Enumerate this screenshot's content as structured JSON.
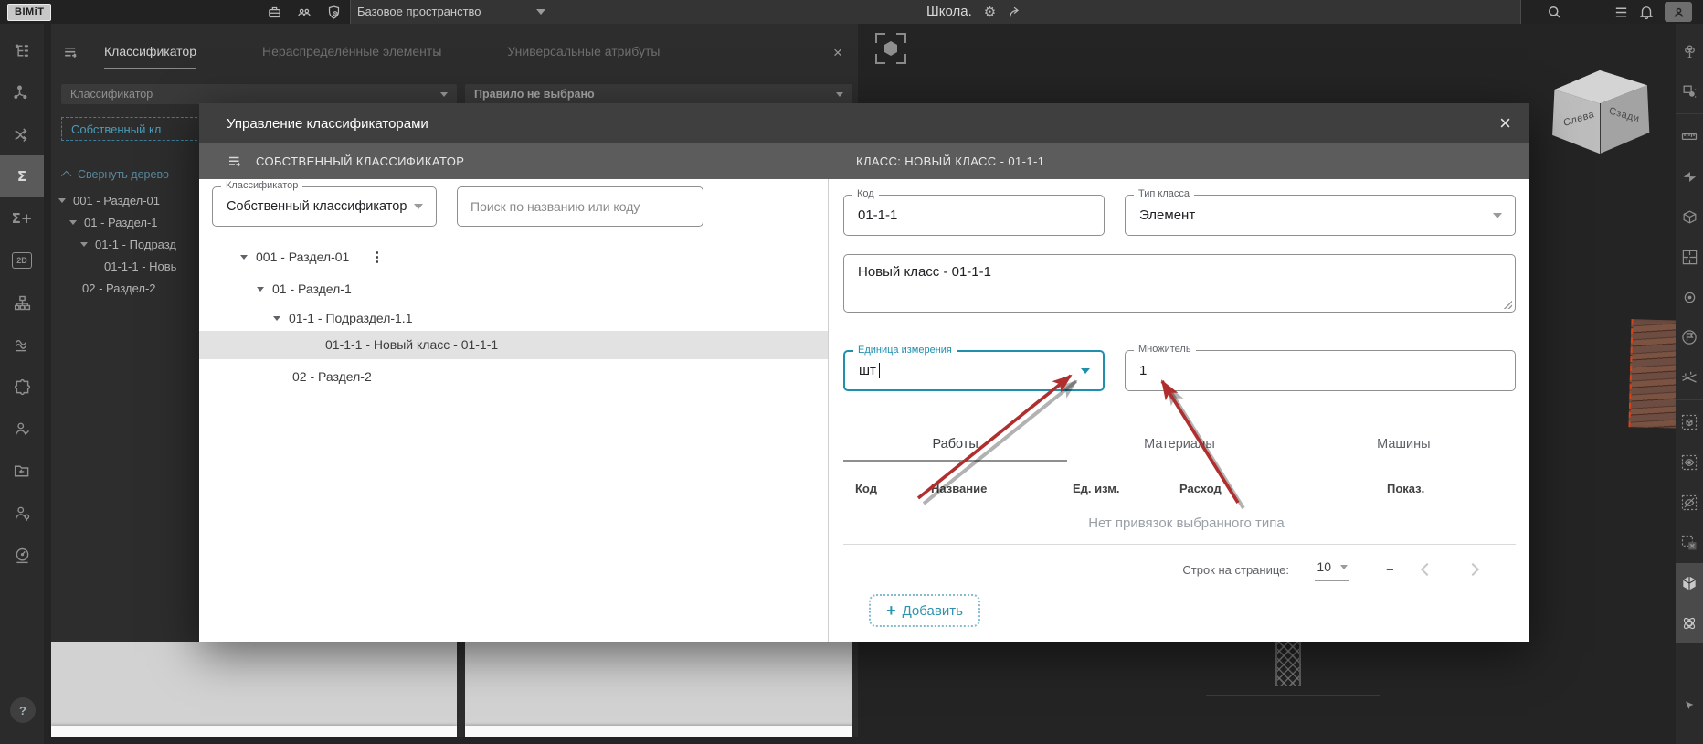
{
  "topbar": {
    "logo": "BIMiT",
    "workspace": "Базовое пространство",
    "project": "Школа."
  },
  "icons": {
    "gear": "⚙",
    "close": "×",
    "kebab": "⋮",
    "plus": "+",
    "dash": "–",
    "help": "?",
    "sigma": "Σ",
    "sigma_plus": "Σ+",
    "two_d": "2D"
  },
  "panel": {
    "tabs": [
      "Классификатор",
      "Нераспределённые элементы",
      "Универсальные атрибуты"
    ],
    "classifier_dropdown": "Классификатор",
    "rule_dropdown": "Правило не выбрано",
    "own_classifier": "Собственный кл",
    "collapse_tree": "Свернуть дерево",
    "tree": [
      "001 - Раздел-01",
      "01 - Раздел-1",
      "01-1 - Подразд",
      "01-1-1 - Новь",
      "02 - Раздел-2"
    ]
  },
  "modal": {
    "title": "Управление классификаторами",
    "left": {
      "header": "СОБСТВЕННЫЙ КЛАССИФИКАТОР",
      "classifier_label": "Классификатор",
      "classifier_value": "Собственный классификатор",
      "search_placeholder": "Поиск по названию или коду",
      "tree": [
        {
          "label": "001 - Раздел-01"
        },
        {
          "label": "01 - Раздел-1"
        },
        {
          "label": "01-1 - Подраздел-1.1"
        },
        {
          "label": "01-1-1 - Новый класс - 01-1-1"
        },
        {
          "label": "02 - Раздел-2"
        }
      ]
    },
    "right": {
      "header": "КЛАСС: НОВЫЙ КЛАСС - 01-1-1",
      "code_label": "Код",
      "code_value": "01-1-1",
      "type_label": "Тип класса",
      "type_value": "Элемент",
      "description": "Новый класс - 01-1-1",
      "unit_label": "Единица измерения",
      "unit_value": "шт",
      "multiplier_label": "Множитель",
      "multiplier_value": "1",
      "tabs": [
        "Работы",
        "Материалы",
        "Машины"
      ],
      "columns": [
        "Код",
        "Название",
        "Ед. изм.",
        "Расход",
        "Показ."
      ],
      "empty_text": "Нет привязок выбранного типа",
      "rows_per_page_label": "Строк на странице:",
      "rows_per_page_value": "10",
      "range": "–",
      "add_button": "Добавить"
    }
  },
  "view_cube": {
    "left_face": "Слева",
    "right_face": "Сзади"
  },
  "colors": {
    "accent_teal": "#1f8fae",
    "arrow_red": "#b02e2e",
    "selection_gray": "#e2e2e2",
    "modal_header_gray": "#5c5c5c"
  }
}
